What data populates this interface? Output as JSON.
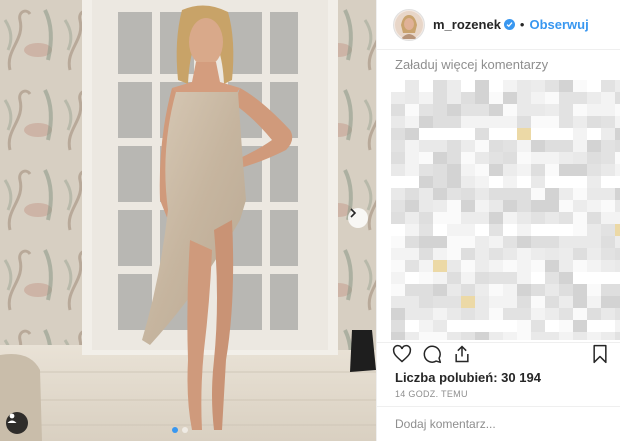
{
  "post": {
    "photo": {
      "description_icon": "photo-of-woman-in-sequined-dress",
      "has_next": true
    },
    "header": {
      "username": "m_rozenek",
      "verified": true,
      "separator": "•",
      "follow_label": "Obserwuj"
    },
    "comments": {
      "load_more_label": "Załaduj więcej komentarzy"
    },
    "actions": {
      "like_icon": "heart-icon",
      "comment_icon": "comment-icon",
      "share_icon": "share-icon",
      "save_icon": "bookmark-icon"
    },
    "likes_text": "Liczba polubień: 30 194",
    "timestamp": "14 GODZ. TEMU",
    "comment_input": {
      "placeholder": "Dodaj komentarz..."
    }
  },
  "colors": {
    "accent": "#3897f0",
    "muted": "#8e8e8e",
    "text": "#262626",
    "border": "#efefef"
  }
}
